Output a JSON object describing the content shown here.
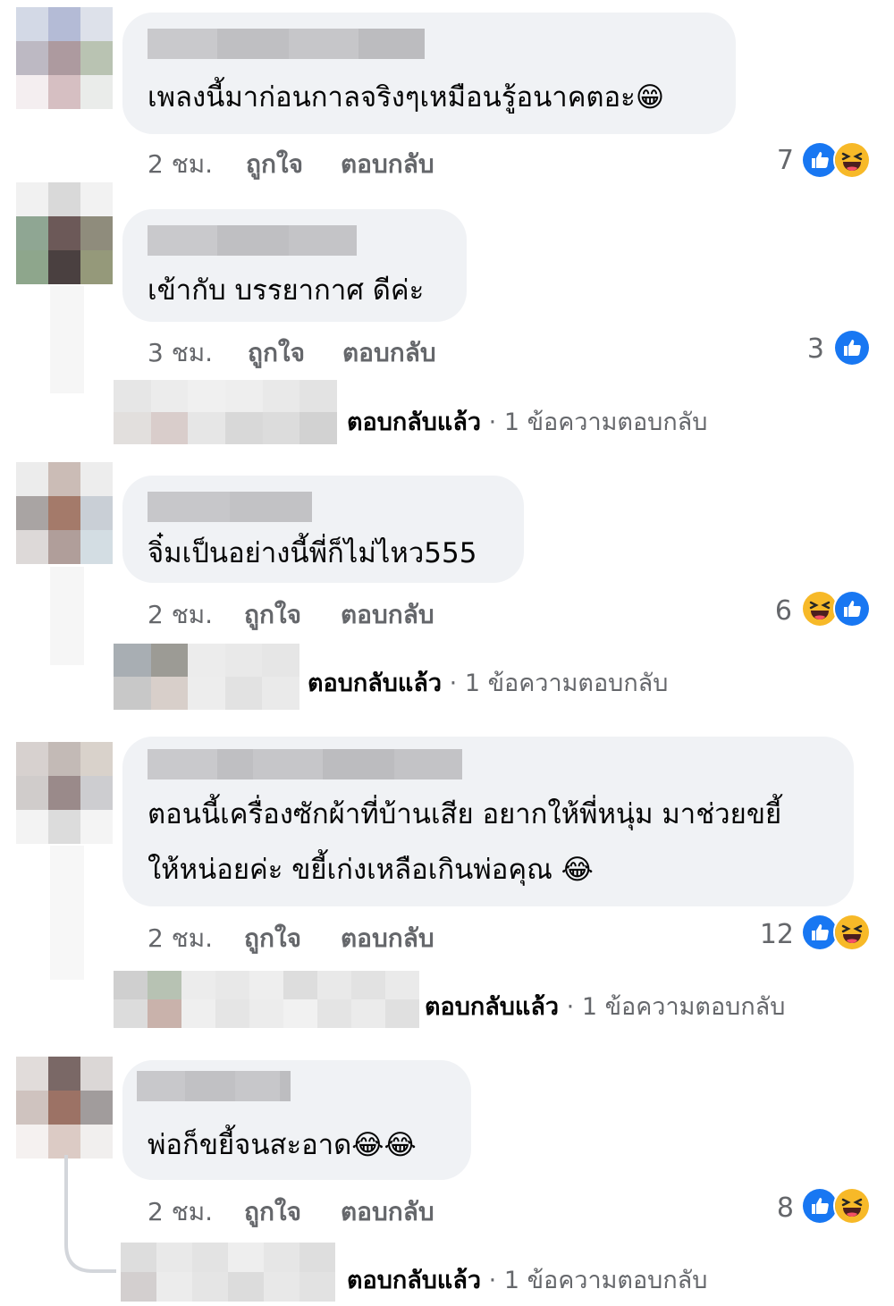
{
  "comments": [
    {
      "text": "เพลงนี้มาก่อนกาลจริงๆเหมือนรู้อนาคตอะ😁",
      "time": "2 ชม.",
      "like_label": "ถูกใจ",
      "reply_label": "ตอบกลับ",
      "reaction_count": "7",
      "reactions": [
        "like-icon",
        "haha-icon"
      ]
    },
    {
      "text": "เข้ากับ บรรยากาศ ดีค่ะ",
      "time": "3 ชม.",
      "like_label": "ถูกใจ",
      "reply_label": "ตอบกลับ",
      "reaction_count": "3",
      "reactions": [
        "like-icon"
      ],
      "reply_summary": {
        "label": "ตอบกลับแล้ว",
        "separator": "·",
        "count": "1 ข้อความตอบกลับ"
      }
    },
    {
      "text": "จิ๋มเป็นอย่างนี้พี่ก็ไม่ไหว555",
      "time": "2 ชม.",
      "like_label": "ถูกใจ",
      "reply_label": "ตอบกลับ",
      "reaction_count": "6",
      "reactions": [
        "haha-icon",
        "like-icon"
      ],
      "reply_summary": {
        "label": "ตอบกลับแล้ว",
        "separator": "·",
        "count": "1 ข้อความตอบกลับ"
      }
    },
    {
      "text_line1": "ตอนนี้เครื่องซักผ้าที่บ้านเสีย อยากให้พี่หนุ่ม มาช่วยขยี้",
      "text_line2": "ให้หน่อยค่ะ ขยี้เก่งเหลือเกินพ่อคุณ 😂",
      "time": "2 ชม.",
      "like_label": "ถูกใจ",
      "reply_label": "ตอบกลับ",
      "reaction_count": "12",
      "reactions": [
        "like-icon",
        "haha-icon"
      ],
      "reply_summary": {
        "label": "ตอบกลับแล้ว",
        "separator": "·",
        "count": "1 ข้อความตอบกลับ"
      }
    },
    {
      "text": "พ่อก็ขยี้จนสะอาด😂😂",
      "time": "2 ชม.",
      "like_label": "ถูกใจ",
      "reply_label": "ตอบกลับ",
      "reaction_count": "8",
      "reactions": [
        "like-icon",
        "haha-icon"
      ],
      "reply_summary": {
        "label": "ตอบกลับแล้ว",
        "separator": "·",
        "count": "1 ข้อความตอบกลับ"
      }
    }
  ],
  "colors": {
    "bubble": "#f0f2f5",
    "secondary_text": "#65676b",
    "like_blue": "#1877f2",
    "haha_yellow": "#f7b928"
  }
}
